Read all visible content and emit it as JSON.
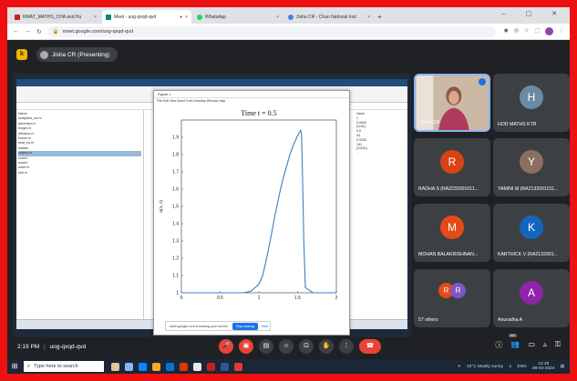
{
  "browser": {
    "tabs": [
      {
        "label": "RMAT_MATHS_CHA and Hu",
        "favicon_color": "#c5221f",
        "active": false
      },
      {
        "label": "Meet - uog-qxqd-qvd",
        "favicon_color": "#00897b",
        "active": true
      },
      {
        "label": "WhatsApp",
        "favicon_color": "#25d366",
        "active": false
      },
      {
        "label": "Jisha CR - Chan National Inst",
        "favicon_color": "#4285f4",
        "active": false
      }
    ],
    "url": "meet.google.com/uog-qxqd-qvd"
  },
  "meet": {
    "presenter_initial": "k",
    "presenting_label": "Jisha CR (Presenting)",
    "meeting_time": "2:19 PM",
    "meeting_code": "uog-qxqd-qvd",
    "people_count": "40",
    "separator": "|"
  },
  "participants": [
    {
      "name": "Jisha CR",
      "type": "camera"
    },
    {
      "name": "HOD MATHS KTR",
      "initial": "H",
      "color": "#6b8ba4"
    },
    {
      "name": "RADHA S (RA2232001011...",
      "initial": "R",
      "color": "#d84315"
    },
    {
      "name": "YAMINI M (RA2132001011...",
      "initial": "Y",
      "color": "#8d6e63"
    },
    {
      "name": "MOHAN BALAKRISHNAN...",
      "initial": "M",
      "color": "#e64a19"
    },
    {
      "name": "KARTHICK V (RA2132001...",
      "initial": "K",
      "color": "#1565c0"
    },
    {
      "name": "57 others",
      "type": "others"
    },
    {
      "name": "Anuradha A",
      "initial": "A",
      "color": "#8e24aa"
    }
  ],
  "others_initials": [
    "R",
    "R"
  ],
  "shared_screen": {
    "share_notice": "meet.google.com is sharing your screen.",
    "stop_sharing": "Stop sharing",
    "hide": "Hide",
    "file_rows": [
      "Name",
      "analytical_sol.m",
      "advection.m",
      "burger.m",
      "diffusion.m",
      "fourier.m",
      "heat_eq.m",
      "matlab",
      "project.m",
      "solve1",
      "solve2",
      "wave.m",
      "trial.m"
    ],
    "selected_row": 8,
    "right_values": [
      "Value",
      "1",
      "0.0500",
      "[1x41]",
      "0.5",
      "40",
      "0.0250",
      "161",
      "[1x161]",
      "..."
    ]
  },
  "chart_data": {
    "type": "line",
    "title": "Time t = 0.5",
    "xlabel": "",
    "ylabel": "u(x, t)",
    "xlim": [
      0,
      2
    ],
    "ylim": [
      1,
      2
    ],
    "xticks": [
      "0",
      "0.5",
      "1",
      "1.5",
      "2"
    ],
    "yticks": [
      "1",
      "1.1",
      "1.2",
      "1.3",
      "1.4",
      "1.5",
      "1.6",
      "1.7",
      "1.8",
      "1.9"
    ],
    "line_color": "#3a7fc0",
    "x": [
      0,
      0.5,
      0.8,
      0.9,
      1.0,
      1.05,
      1.1,
      1.15,
      1.2,
      1.25,
      1.3,
      1.35,
      1.4,
      1.45,
      1.5,
      1.54,
      1.55,
      1.56,
      1.58,
      1.6,
      1.7,
      2.0
    ],
    "y": [
      1.0,
      1.0,
      1.0,
      1.01,
      1.05,
      1.1,
      1.2,
      1.31,
      1.43,
      1.54,
      1.64,
      1.72,
      1.8,
      1.86,
      1.91,
      1.94,
      1.92,
      1.75,
      1.3,
      1.03,
      1.0,
      1.0
    ]
  },
  "bottom_controls": [
    "mic-off",
    "camera-off",
    "captions",
    "emoji",
    "present",
    "raise-hand",
    "more"
  ],
  "taskbar": {
    "search_placeholder": "Type here to search",
    "weather": "34°C  Mostly sunny",
    "lang": "ENG",
    "time": "14:19",
    "date": "08-04-2024"
  }
}
